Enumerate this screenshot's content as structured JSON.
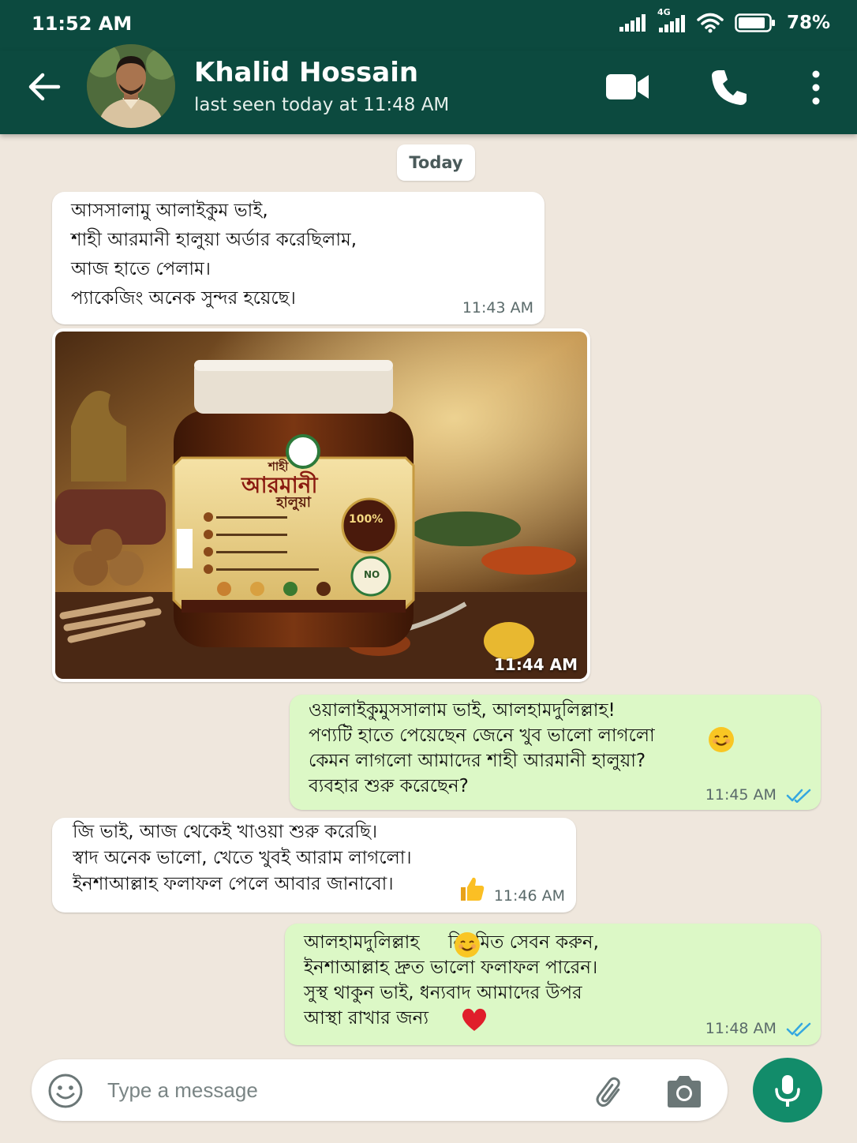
{
  "status_bar": {
    "time": "11:52 AM",
    "network": "4G",
    "battery": "78%"
  },
  "header": {
    "contact_name": "Khalid Hossain",
    "last_seen": "last seen today at 11:48 AM",
    "icons": [
      "back-arrow-icon",
      "video-call-icon",
      "phone-icon",
      "more-vert-icon"
    ]
  },
  "chat": {
    "date_chip": "Today",
    "messages": [
      {
        "direction": "incoming",
        "text": "আসসালামু আলাইকুম ভাই,\nশাহী আরমানী হালুয়া অর্ডার করেছিলাম,\nআজ হাতে পেলাম।\nপ্যাকেজিং অনেক সুন্দর হয়েছে।",
        "time": "11:43 AM"
      },
      {
        "direction": "incoming",
        "type": "image",
        "time": "11:44 AM",
        "image_label": {
          "brand_top": "শাহী",
          "brand_main": "আরমানী",
          "brand_sub": "হালুয়া",
          "badge": "100%",
          "badge_no": "NO"
        }
      },
      {
        "direction": "outgoing",
        "text": "ওয়ালাইকুমুসসালাম ভাই, আলহামদুলিল্লাহ!\nপণ্যটি হাতে পেয়েছেন জেনে খুব ভালো লাগলো\nকেমন লাগলো আমাদের শাহী আরমানী হালুয়া?\nব্যবহার শুরু করেছেন?",
        "time": "11:45 AM",
        "emoji": "smiling-face",
        "status": "read"
      },
      {
        "direction": "incoming",
        "text": "জি ভাই, আজ থেকেই খাওয়া শুরু করেছি।\nস্বাদ অনেক ভালো, খেতে খুবই আরাম লাগলো।\nইনশাআল্লাহ ফলাফল পেলে আবার জানাবো।",
        "time": "11:46 AM",
        "emoji": "thumbs-up"
      },
      {
        "direction": "outgoing",
        "text": "আলহামদুলিল্লাহ     নিয়মিত সেবন করুন,\nইনশাআল্লাহ দ্রুত ভালো ফলাফল পারেন।\nসুস্থ থাকুন ভাই, ধন্যবাদ আমাদের উপর\nআস্থা রাখার জন্য",
        "time": "11:48 AM",
        "emoji": "red-heart",
        "status": "read"
      }
    ]
  },
  "composer": {
    "placeholder": "Type a message",
    "value": "",
    "icons": [
      "emoji-icon",
      "attach-icon",
      "camera-icon",
      "mic-icon"
    ]
  },
  "colors": {
    "header_bg": "#0c4a3f",
    "chat_bg": "#efe7dd",
    "outgoing_bubble": "#dcf8c6",
    "incoming_bubble": "#ffffff",
    "read_ticks": "#34a7e0",
    "mic_button": "#128c6a"
  }
}
